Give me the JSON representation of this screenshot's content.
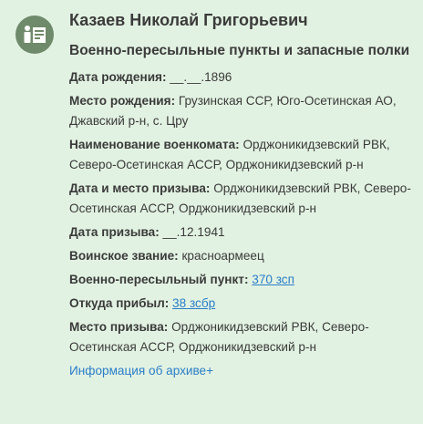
{
  "person": {
    "name": "Казаев Николай Григорьевич",
    "unit": "Военно-пересыльные пункты и запасные полки"
  },
  "fields": {
    "birth_date": {
      "label": "Дата рождения:",
      "value": "__.__.1896"
    },
    "birth_place": {
      "label": "Место рождения:",
      "value": "Грузинская ССР, Юго-Осетинская АО, Джавский р-н, с. Цру"
    },
    "commissariat": {
      "label": "Наименование военкомата:",
      "value": "Орджоникидзевский РВК, Северо-Осетинская АССР, Орджоникидзевский р-н"
    },
    "draft_date_place": {
      "label": "Дата и место призыва:",
      "value": "Орджоникидзевский РВК, Северо-Осетинская АССР, Орджоникидзевский р-н"
    },
    "draft_date": {
      "label": "Дата призыва:",
      "value": "__.12.1941"
    },
    "rank": {
      "label": "Воинское звание:",
      "value": "красноармеец"
    },
    "transit_point": {
      "label": "Военно-пересыльный пункт:",
      "value": "370 зсп"
    },
    "arrived_from": {
      "label": "Откуда прибыл:",
      "value": "38 зсбр"
    },
    "draft_place": {
      "label": "Место призыва:",
      "value": "Орджоникидзевский РВК, Северо-Осетинская АССР, Орджоникидзевский р-н"
    }
  },
  "archive_link": "Информация об архиве+",
  "icons": {
    "avatar": "person-document-icon"
  },
  "colors": {
    "background": "#e2f2e2",
    "avatar": "#6f8a6a",
    "link": "#2a7ec8"
  }
}
